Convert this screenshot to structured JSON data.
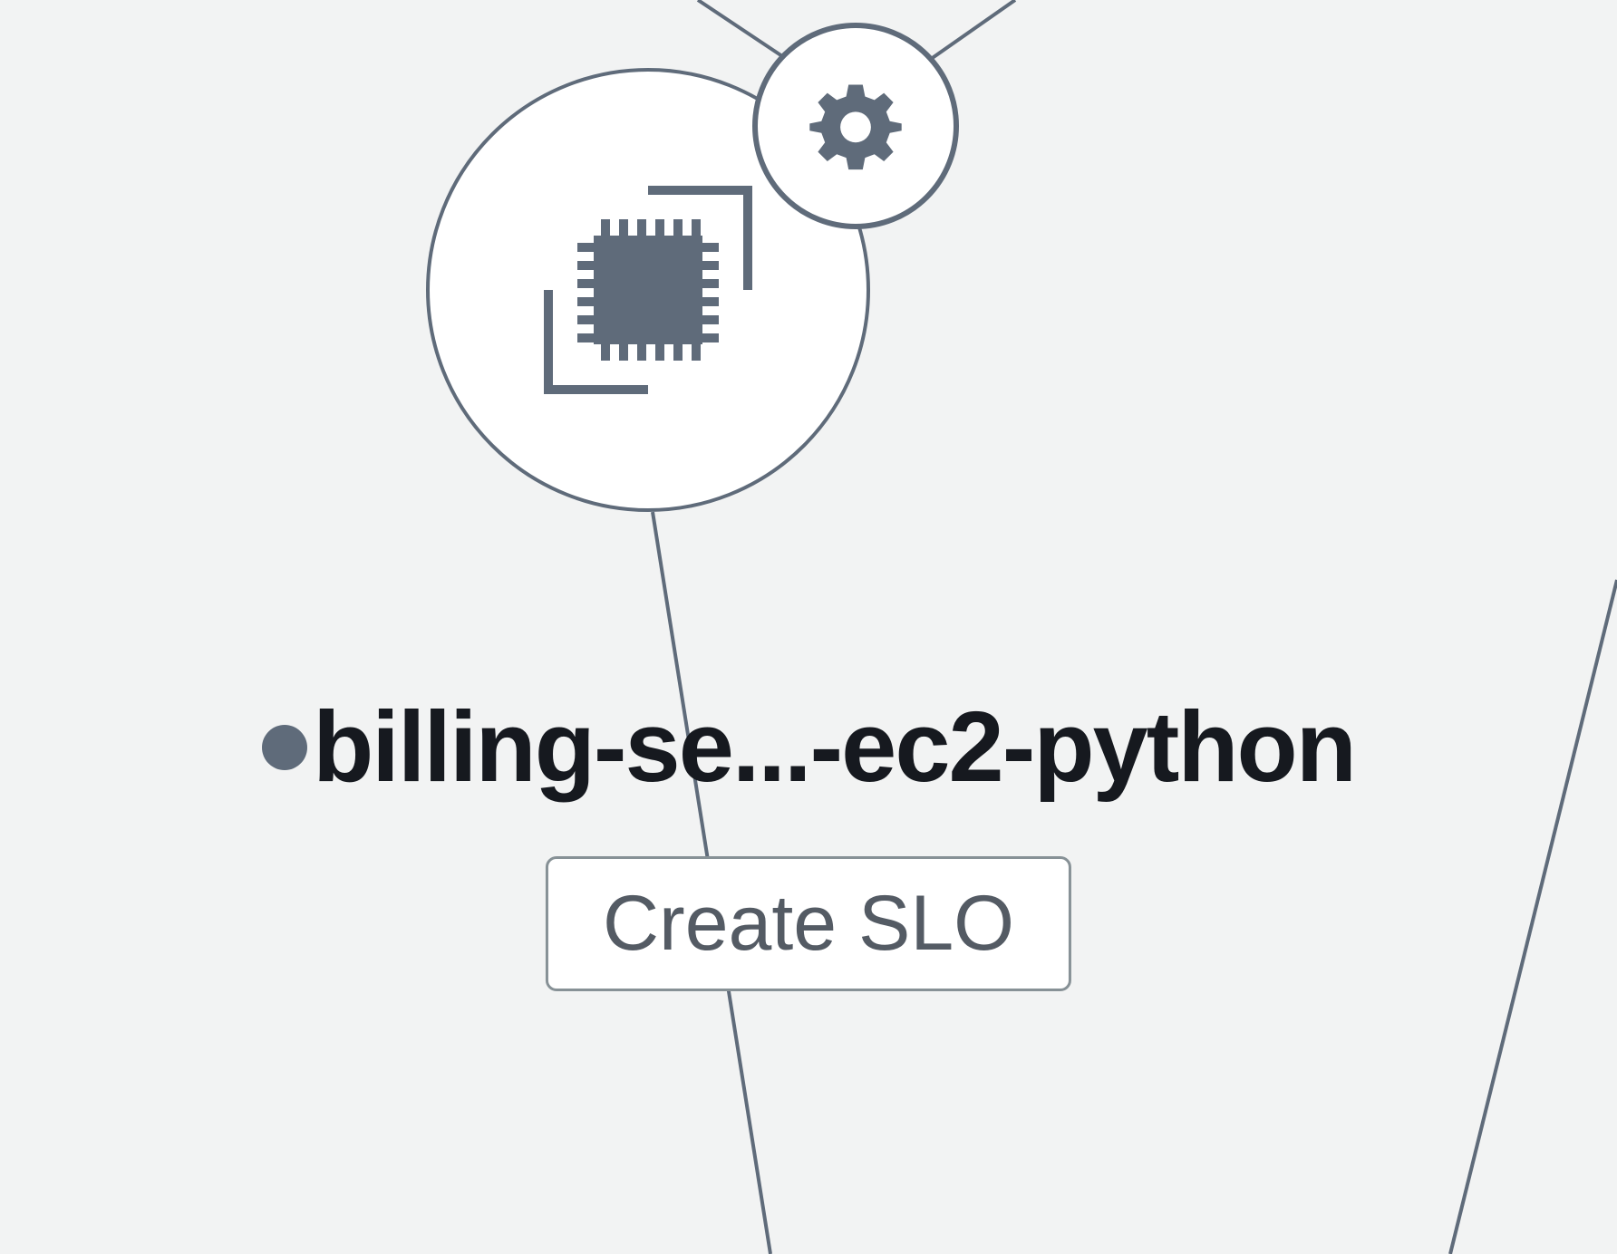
{
  "node": {
    "label": "billing-se...-ec2-python",
    "icon": "chip-icon",
    "badge_icon": "gear-icon",
    "status_color": "#5f6b7a"
  },
  "actions": {
    "create_slo_label": "Create SLO"
  },
  "colors": {
    "background": "#f2f3f3",
    "node_fill": "#ffffff",
    "stroke": "#5f6b7a",
    "text": "#16191f",
    "button_text": "#545b64",
    "button_border": "#879196"
  }
}
